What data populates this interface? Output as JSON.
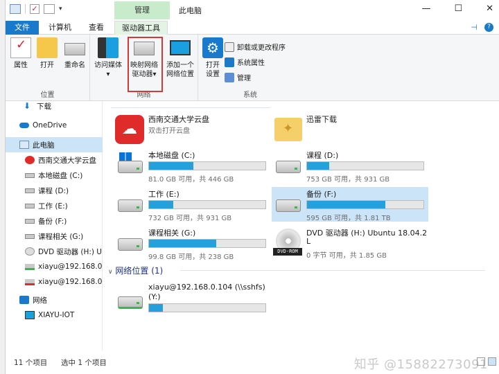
{
  "window": {
    "title": "此电脑",
    "context_tab": "管理",
    "minimize": "—",
    "maximize": "☐",
    "close": "✕"
  },
  "ribbon_tabs": [
    "文件",
    "计算机",
    "查看",
    "驱动器工具"
  ],
  "ribbon": {
    "groups": {
      "location": "位置",
      "network": "网络",
      "system": "系统"
    },
    "buttons": {
      "properties": "属性",
      "open": "打开",
      "rename": "重命名",
      "access_media": "访问媒体",
      "map_drive_line1": "映射网络",
      "map_drive_line2": "驱动器",
      "add_location_line1": "添加一个",
      "add_location_line2": "网络位置",
      "open_settings_line1": "打开",
      "open_settings_line2": "设置",
      "uninstall": "卸载或更改程序",
      "system_props": "系统属性",
      "manage": "管理"
    }
  },
  "sidebar": {
    "items": [
      {
        "label": "下载",
        "icon": "download-arrow-icon"
      },
      {
        "label": "OneDrive",
        "icon": "cloud-icon"
      },
      {
        "label": "此电脑",
        "icon": "computer-icon",
        "selected": true
      },
      {
        "label": "西南交通大学云盘",
        "icon": "red-cloud-icon"
      },
      {
        "label": "本地磁盘 (C:)",
        "icon": "drive-icon"
      },
      {
        "label": "课程 (D:)",
        "icon": "drive-icon"
      },
      {
        "label": "工作 (E:)",
        "icon": "drive-icon"
      },
      {
        "label": "备份 (F:)",
        "icon": "drive-icon"
      },
      {
        "label": "课程相关 (G:)",
        "icon": "drive-icon"
      },
      {
        "label": "DVD 驱动器 (H:) U",
        "icon": "dvd-icon"
      },
      {
        "label": "xiayu@192.168.0.1",
        "icon": "network-drive-icon"
      },
      {
        "label": "xiayu@192.168.0.1",
        "icon": "network-drive-error-icon"
      },
      {
        "label": "网络",
        "icon": "network-icon"
      },
      {
        "label": "XIAYU-IOT",
        "icon": "monitor-icon"
      }
    ]
  },
  "apps": [
    {
      "name": "西南交通大学云盘",
      "sub": "双击打开云盘"
    },
    {
      "name": "迅雷下载",
      "sub": ""
    }
  ],
  "drives": [
    {
      "name": "本地磁盘 (C:)",
      "usage": "81.0 GB 可用，共 446 GB",
      "fill": 0.38
    },
    {
      "name": "课程 (D:)",
      "usage": "753 GB 可用，共 931 GB",
      "fill": 0.19
    },
    {
      "name": "工作 (E:)",
      "usage": "732 GB 可用，共 931 GB",
      "fill": 0.21
    },
    {
      "name": "备份 (F:)",
      "usage": "595 GB 可用，共 1.81 TB",
      "fill": 0.67
    },
    {
      "name": "课程相关 (G:)",
      "usage": "99.8 GB 可用，共 238 GB",
      "fill": 0.58
    },
    {
      "name_line1": "DVD 驱动器 (H:) Ubuntu 18.04.2",
      "name_line2": "L",
      "usage": "0 字节 可用，共 1.85 GB",
      "label": "DVD-ROM"
    }
  ],
  "network_section": {
    "heading": "网络位置 (1)",
    "item_line1": "xiayu@192.168.0.104 (\\\\sshfs)",
    "item_line2": "(Y:)",
    "fill": 0.12
  },
  "status": {
    "count": "11 个项目",
    "selected": "选中 1 个项目",
    "watermark": "知乎 @15882273091"
  },
  "colors": {
    "accent": "#1979ca",
    "bar_fill": "#26a0da",
    "selection": "#cce4f7",
    "highlight_box": "#d23a3a"
  }
}
